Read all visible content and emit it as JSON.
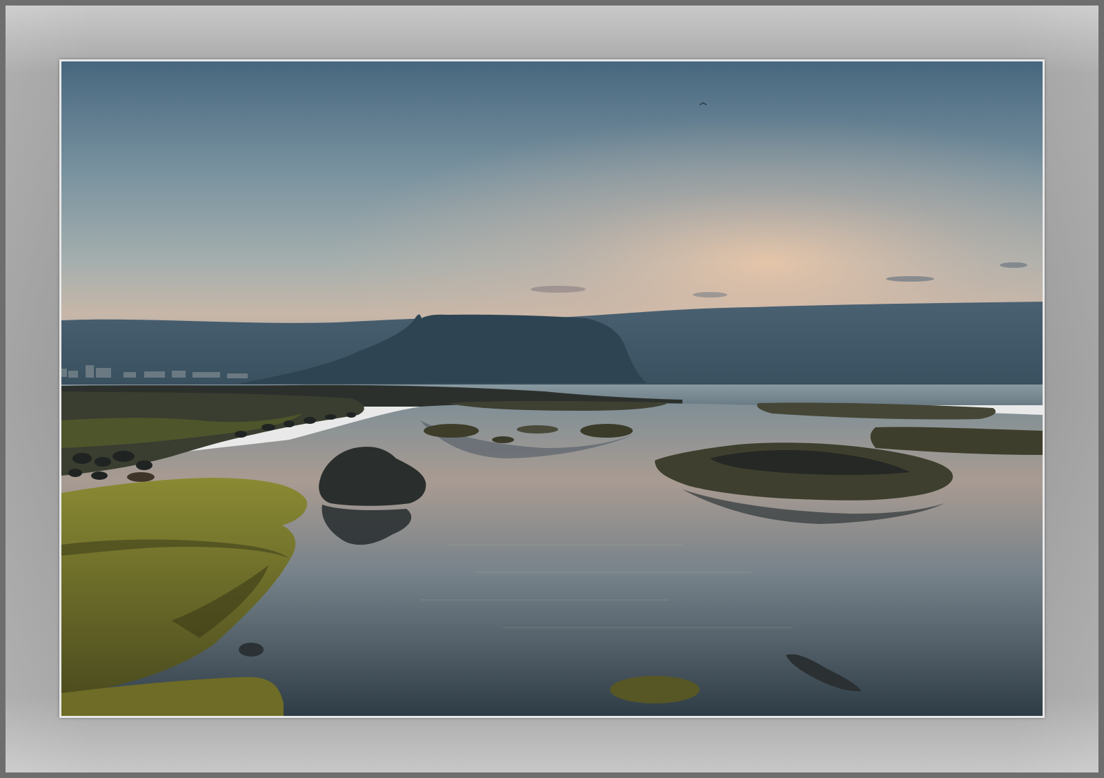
{
  "image": {
    "subject": "coastal-landscape-photo",
    "colors": {
      "sky_top": "#47677f",
      "sky_mid": "#93a6ad",
      "sky_glow": "#e6c2a6",
      "cloud_bank": "#3d5363",
      "mountain": "#2f4452",
      "sea": "#6f8590",
      "water_reflection": "#b9a89a",
      "moss": "#7e7d2c",
      "rock_dark": "#232624",
      "frame_gray": "#9a9a9a"
    }
  }
}
